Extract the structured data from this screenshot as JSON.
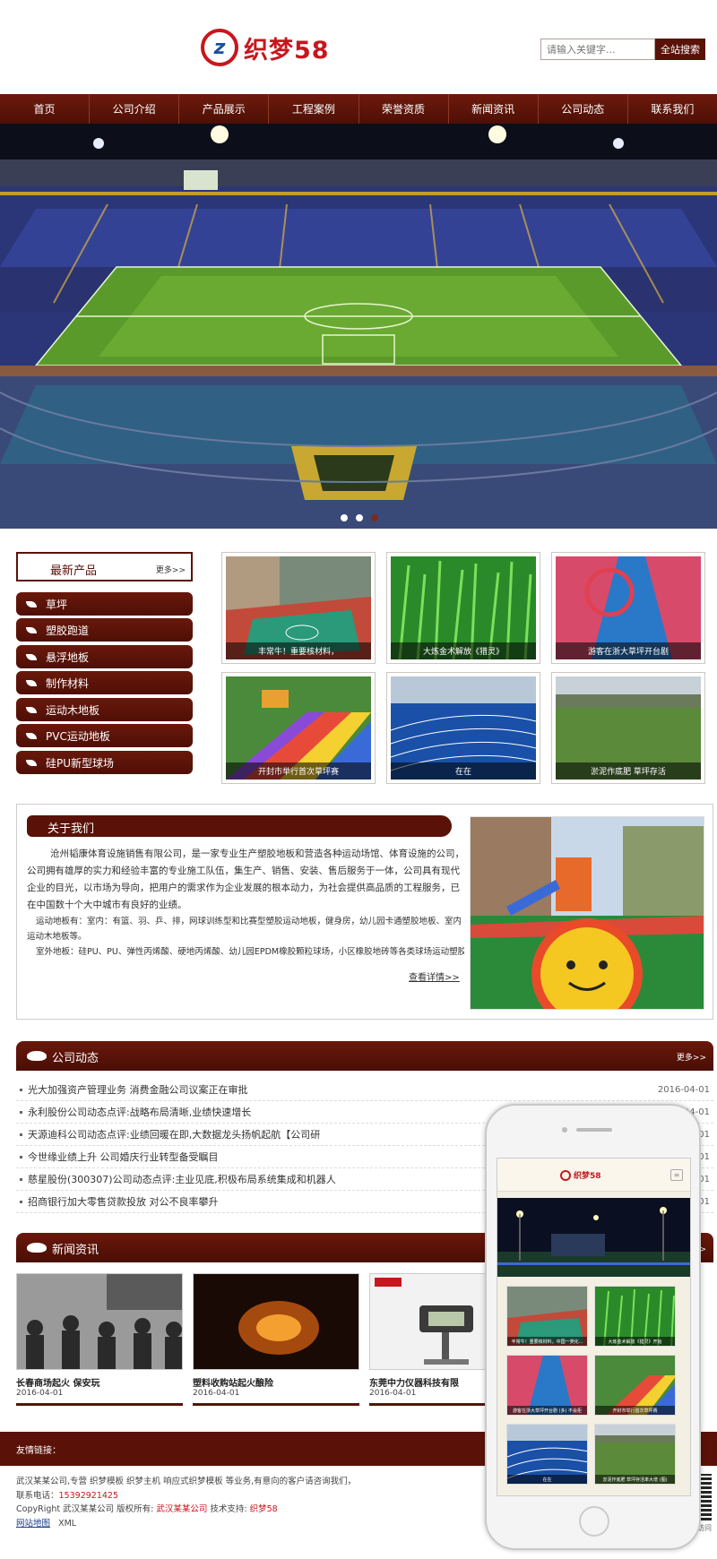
{
  "header": {
    "logo_text": "织梦58",
    "search_placeholder": "请输入关键字...",
    "search_button": "全站搜索"
  },
  "nav": [
    "首页",
    "公司介绍",
    "产品展示",
    "工程案例",
    "荣誉资质",
    "新闻资讯",
    "公司动态",
    "联系我们"
  ],
  "banner": {
    "slides": 3,
    "active": 1
  },
  "products": {
    "title": "最新产品",
    "more": "更多>>",
    "categories": [
      "草坪",
      "塑胶跑道",
      "悬浮地板",
      "制作材料",
      "运动木地板",
      "PVC运动地板",
      "硅PU新型球场"
    ],
    "items": [
      "丰常牛！重要核材料，",
      "大炼金术解放《猎灵》",
      "游客在浙大草坪开台剧",
      "开封市举行首次草坪赛",
      "在在",
      "淤泥作底肥 草坪存活"
    ]
  },
  "about": {
    "title": "关于我们",
    "para1": "沧州韬康体育设施销售有限公司，是一家专业生产塑胶地板和营造各种运动场馆、体育设施的公司，公司拥有雄厚的实力和经验丰富的专业施工队伍，集生产、销售、安装、售后服务于一体，公司具有现代企业的目光，以市场为导向，把用户的需求作为企业发展的根本动力，为社会提供高品质的工程服务，已在中国数十个大中城市有良好的业绩。",
    "para2": "运动地板有：室内：有篮、羽、乒、排，网球训练型和比赛型塑胶运动地板，健身房，幼儿园卡通塑胶地板、室内运动木地板等。",
    "para3": "室外地板：硅PU、PU、弹性丙烯酸、硬地丙烯酸、幼儿园EPDM橡胶颗粒球场，小区橡胶地砖等各类球场运动塑胶",
    "more": "查看详情>>"
  },
  "company_news": {
    "title": "公司动态",
    "more": "更多>>",
    "items": [
      {
        "title": "光大加强资产管理业务 消费金融公司议案正在审批",
        "date": "2016-04-01"
      },
      {
        "title": "永利股份公司动态点评:战略布局清晰,业绩快速增长",
        "date": "2016-04-01"
      },
      {
        "title": "天源迪科公司动态点评:业绩回暖在即,大数据龙头扬帆起航【公司研",
        "date": "2016-04-01"
      },
      {
        "title": "今世缘业绩上升 公司婚庆行业转型备受瞩目",
        "date": "2016-04-01"
      },
      {
        "title": "慈星股份(300307)公司动态点评:主业见底,积极布局系统集成和机器人",
        "date": "2016-04-01"
      },
      {
        "title": "招商银行加大零售贷款投放 对公不良率攀升",
        "date": "2016-04-01"
      }
    ]
  },
  "news": {
    "title": "新闻资讯",
    "more": "更多>>",
    "items": [
      {
        "title": "长春商场起火 保安玩",
        "date": "2016-04-01"
      },
      {
        "title": "塑料收购站起火酿险",
        "date": "2016-04-01"
      },
      {
        "title": "东莞中力仪器科技有限",
        "date": "2016-04-01"
      }
    ]
  },
  "footer": {
    "links_label": "友情链接：",
    "line1": "武汉某某公司,专营  织梦模板    织梦主机    响应式织梦模板    等业务,有意向的客户请咨询我们，",
    "phone_label": "联系电话：",
    "phone": "15392921425",
    "copyright_prefix": "CopyRight 武汉某某公司 版权所有: ",
    "copyright_company": "武汉某某公司",
    "tech_label": "   技术支持: ",
    "tech": "织梦58",
    "sitemap": "网站地图",
    "xml": "XML",
    "qr_label": "访问"
  },
  "mobile": {
    "logo_text": "织梦58",
    "menu_icon": "≡",
    "thumbs": [
      "丰常牛！重要核材料，中国一类化...",
      "大炼金术解放《猎灵》开始",
      "游客在浙大草坪开台剧 (多) 不会拒",
      "开封市举行首次草坪赛",
      "在在",
      "淤泥作底肥 草坪存活率大增 (图)"
    ]
  },
  "colors": {
    "brand": "#5a1208",
    "logo_red": "#c8161d",
    "logo_blue": "#1b4fa0"
  }
}
